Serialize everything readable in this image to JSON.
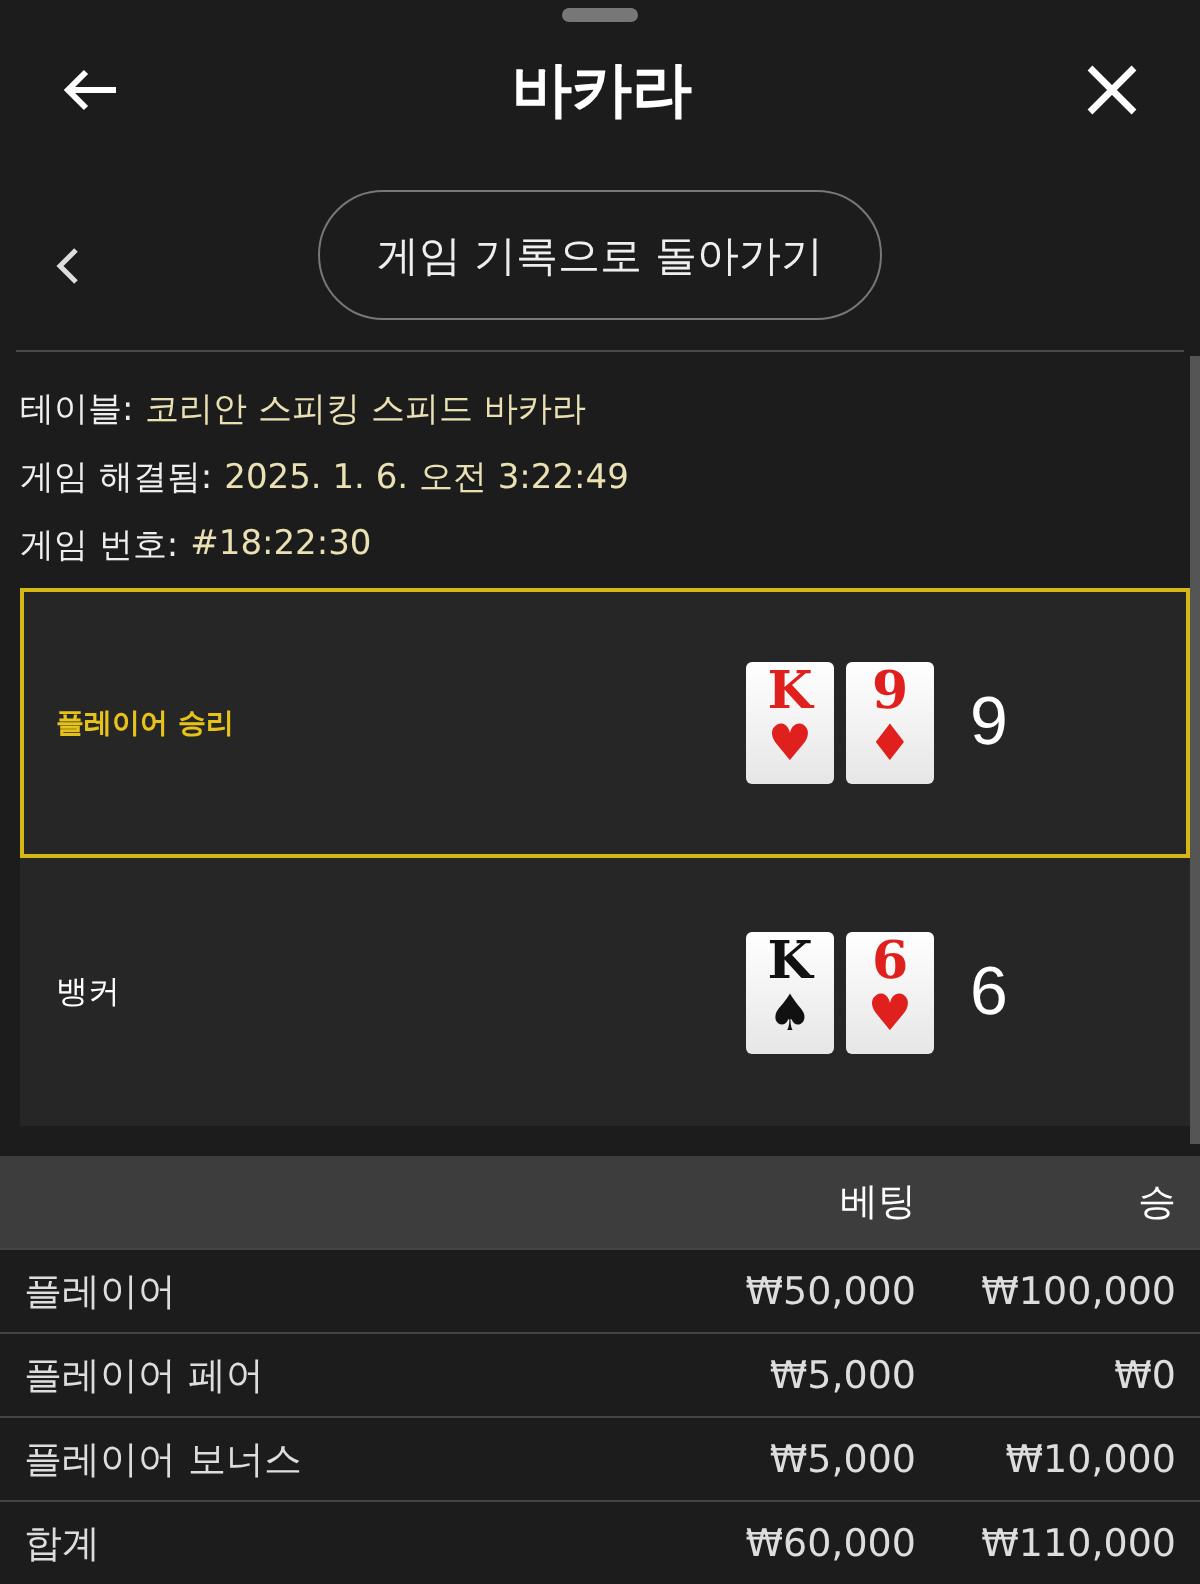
{
  "header": {
    "title": "바카라"
  },
  "back_button": {
    "label": "게임 기록으로 돌아가기"
  },
  "info": [
    {
      "label": "테이블:",
      "value": "코리안 스피킹 스피드 바카라"
    },
    {
      "label": "게임 해결됨:",
      "value": "2025. 1. 6. 오전 3:22:49"
    },
    {
      "label": "게임 번호:",
      "value": "#18:22:30"
    }
  ],
  "hands": [
    {
      "label": "플레이어 승리",
      "winner": true,
      "score": "9",
      "cards": [
        {
          "rank": "K",
          "suit": "♥",
          "color": "#e0201c"
        },
        {
          "rank": "9",
          "suit": "♦",
          "color": "#e0201c"
        }
      ]
    },
    {
      "label": "뱅커",
      "winner": false,
      "score": "6",
      "cards": [
        {
          "rank": "K",
          "suit": "♠",
          "color": "#111111"
        },
        {
          "rank": "6",
          "suit": "♥",
          "color": "#e0201c"
        }
      ]
    }
  ],
  "table": {
    "columns": [
      "베팅",
      "승"
    ],
    "rows": [
      {
        "name": "플레이어",
        "bet": "₩50,000",
        "win": "₩100,000"
      },
      {
        "name": "플레이어 페어",
        "bet": "₩5,000",
        "win": "₩0"
      },
      {
        "name": "플레이어 보너스",
        "bet": "₩5,000",
        "win": "₩10,000"
      },
      {
        "name": "합계",
        "bet": "₩60,000",
        "win": "₩110,000"
      }
    ]
  }
}
